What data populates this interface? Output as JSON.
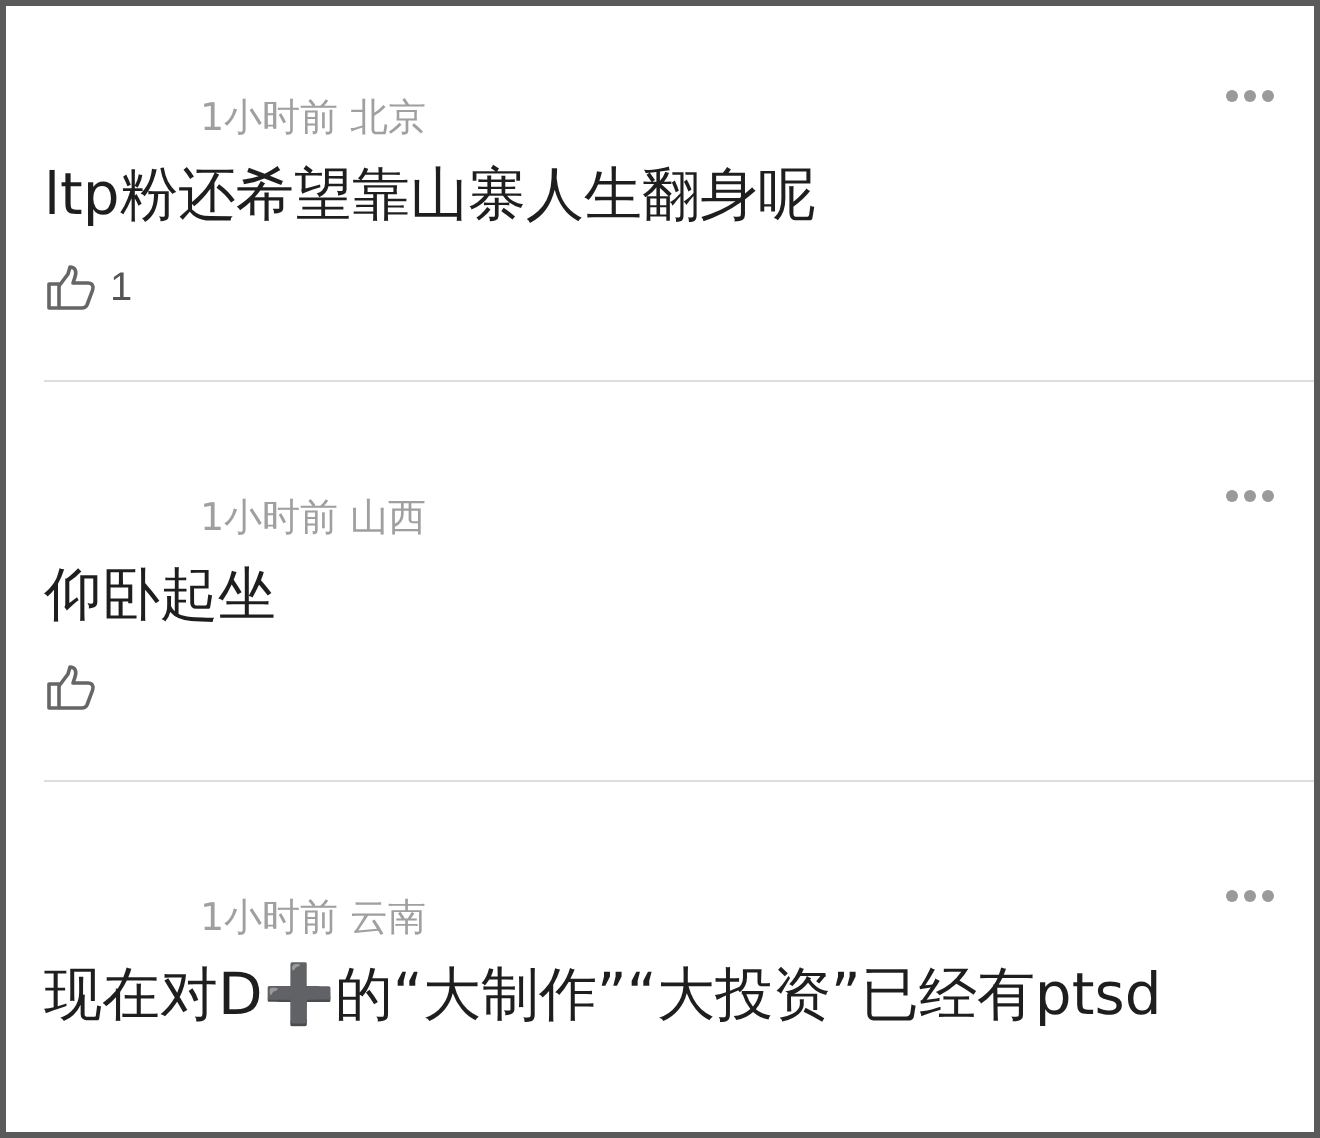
{
  "comments": [
    {
      "time": "1小时前",
      "location": "北京",
      "text": "ltp粉还希望靠山寨人生翻身呢",
      "like_button_shown": true,
      "like_count": "1"
    },
    {
      "time": "1小时前",
      "location": "山西",
      "text": "仰卧起坐",
      "like_button_shown": true
    },
    {
      "time": "1小时前",
      "location": "云南",
      "text": "现在对D➕的“大制作”“大投资”已经有ptsd",
      "like_button_shown": false
    }
  ]
}
